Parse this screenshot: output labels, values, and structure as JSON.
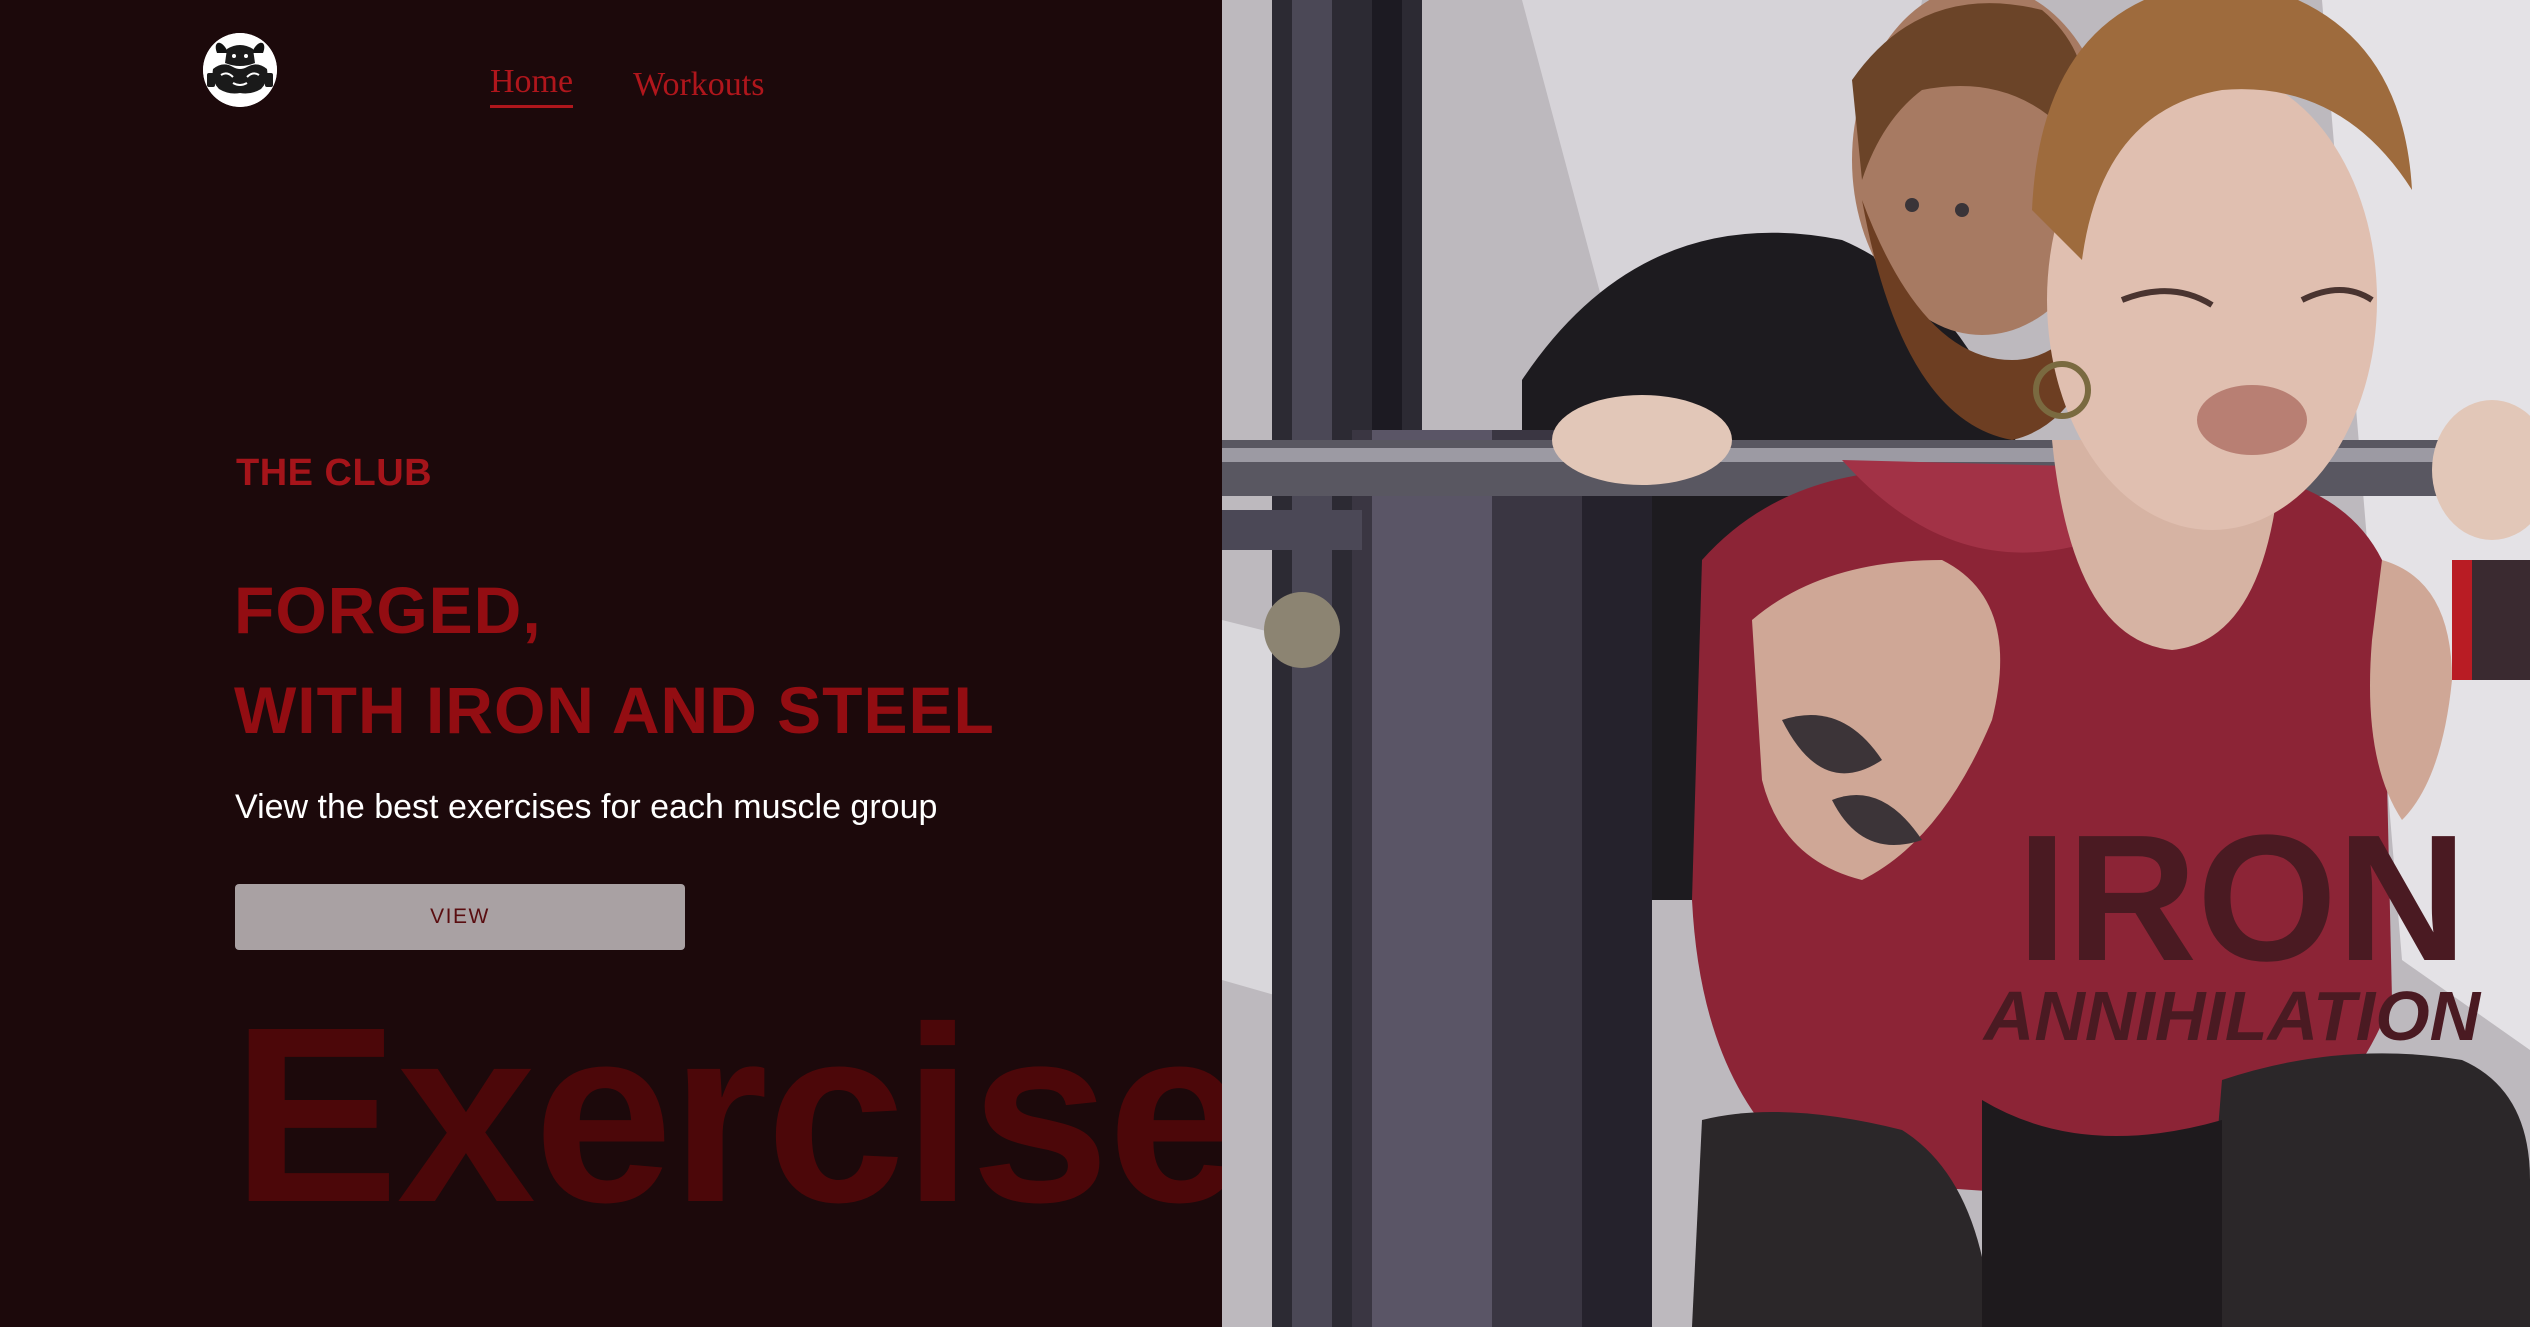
{
  "nav": {
    "items": [
      {
        "label": "Home",
        "active": true
      },
      {
        "label": "Workouts",
        "active": false
      }
    ]
  },
  "hero": {
    "kicker": "THE CLUB",
    "headline_line1": "FORGED,",
    "headline_line2": "WITH IRON AND STEEL",
    "subtitle": "View the best exercises for each muscle group",
    "button_label": "VIEW",
    "background_word": "Exercise"
  },
  "photo": {
    "shirt_text_line1": "IRON",
    "shirt_text_line2": "ANNIHILATION"
  },
  "icons": {
    "logo": "bull-logo-icon"
  },
  "colors": {
    "background": "#1c090b",
    "accent": "#b0161c",
    "headline": "#930d12",
    "button_bg": "#a9a1a3",
    "button_text": "#5a0d10",
    "background_word": "#4c0709"
  }
}
